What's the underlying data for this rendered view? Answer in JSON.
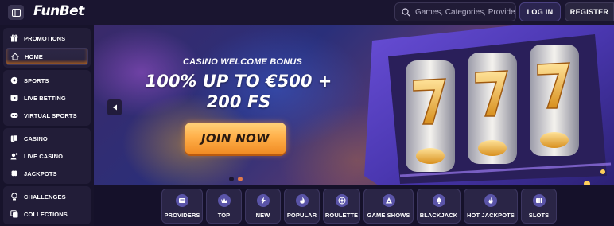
{
  "header": {
    "menu_icon": "sidebar-toggle-icon",
    "logo": "FunBet",
    "search_placeholder": "Games, Categories, Providers",
    "login_label": "LOG IN",
    "register_label": "REGISTER"
  },
  "sidebar": {
    "groups": [
      {
        "items": [
          {
            "label": "PROMOTIONS",
            "icon": "gift-icon"
          },
          {
            "label": "HOME",
            "icon": "home-icon",
            "active": true
          }
        ]
      },
      {
        "items": [
          {
            "label": "SPORTS",
            "icon": "soccer-ball-icon"
          },
          {
            "label": "LIVE BETTING",
            "icon": "play-icon"
          },
          {
            "label": "VIRTUAL SPORTS",
            "icon": "virtual-icon"
          }
        ]
      },
      {
        "items": [
          {
            "label": "CASINO",
            "icon": "cards-icon"
          },
          {
            "label": "LIVE CASINO",
            "icon": "live-casino-icon"
          },
          {
            "label": "JACKPOTS",
            "icon": "clover-icon"
          }
        ]
      },
      {
        "items": [
          {
            "label": "CHALLENGES",
            "icon": "trophy-icon"
          },
          {
            "label": "COLLECTIONS",
            "icon": "collections-icon"
          }
        ]
      }
    ]
  },
  "banner": {
    "subtitle": "CASINO WELCOME BONUS",
    "title": "100% UP TO €500 + 200 FS",
    "cta_label": "JOIN NOW",
    "slide_count": 2,
    "active_slide": 2,
    "accent_color": "#f7a13a"
  },
  "categories": [
    {
      "label": "PROVIDERS",
      "icon": "providers-icon"
    },
    {
      "label": "TOP",
      "icon": "crown-icon"
    },
    {
      "label": "NEW",
      "icon": "lightning-icon"
    },
    {
      "label": "POPULAR",
      "icon": "flame-icon"
    },
    {
      "label": "ROULETTE",
      "icon": "roulette-icon"
    },
    {
      "label": "GAME SHOWS",
      "icon": "game-shows-icon"
    },
    {
      "label": "BLACKJACK",
      "icon": "spade-icon"
    },
    {
      "label": "HOT JACKPOTS",
      "icon": "hot-jackpot-icon"
    },
    {
      "label": "SLOTS",
      "icon": "slots-icon"
    }
  ]
}
